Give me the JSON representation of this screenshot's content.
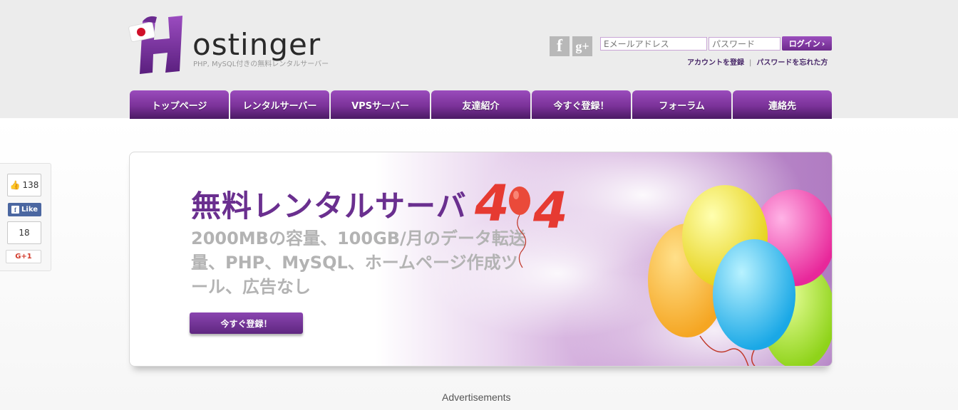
{
  "header": {
    "logo_text": "ostinger",
    "tagline": "PHP, MySQL付きの無料レンタルサーバー",
    "social": {
      "facebook_glyph": "f",
      "gplus_glyph": "g+"
    },
    "login": {
      "email_placeholder": "Eメールアドレス",
      "password_placeholder": "パスワード",
      "button_label": "ログイン",
      "register_link": "アカウントを登録",
      "separator": "|",
      "forgot_link": "パスワードを忘れた方"
    }
  },
  "nav": {
    "items": [
      "トップページ",
      "レンタルサーバー",
      "VPSサーバー",
      "友達紹介",
      "今すぐ登録！",
      "フォーラム",
      "連絡先"
    ]
  },
  "share": {
    "like_count": "138",
    "like_label": "Like",
    "plus_count": "18",
    "gplus_label": "G+1"
  },
  "banner": {
    "title": "無料レンタルサーバ",
    "subtitle": "2000MBの容量、100GB/月のデータ転送量、PHP、MySQL、ホームページ作成ツール、広告なし",
    "button_label": "今すぐ登録！",
    "deco_404": "404"
  },
  "footer": {
    "ads_label": "Advertisements"
  },
  "colors": {
    "brand_purple": "#7b3299",
    "title_purple": "#6a2f8f",
    "band_grey": "#ececec"
  }
}
